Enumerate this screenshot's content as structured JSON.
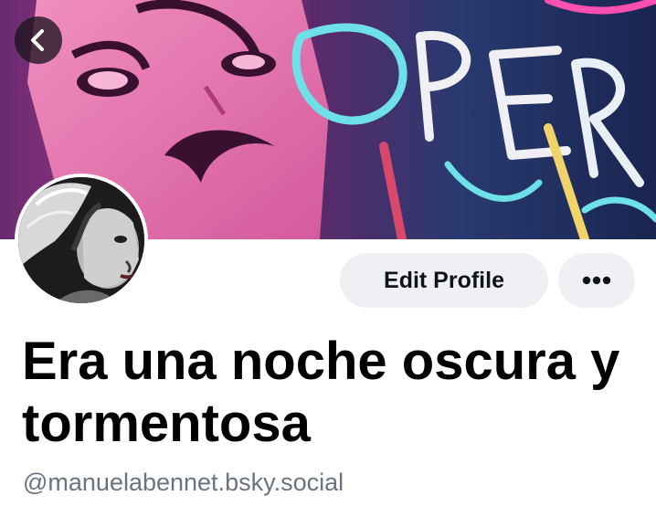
{
  "profile": {
    "display_name": "Era una noche oscura y tormentosa",
    "handle": "@manuelabennet.bsky.social",
    "banner_image": "pop-art-woman-neon-sign-banner",
    "avatar_image": "black-and-white-portrait-avatar"
  },
  "actions": {
    "edit_profile_label": "Edit Profile",
    "more_icon": "ellipsis-icon",
    "back_icon": "chevron-left-icon"
  },
  "colors": {
    "button_background": "#eef0f4",
    "text_primary": "#000000",
    "text_secondary": "#6a7380"
  }
}
